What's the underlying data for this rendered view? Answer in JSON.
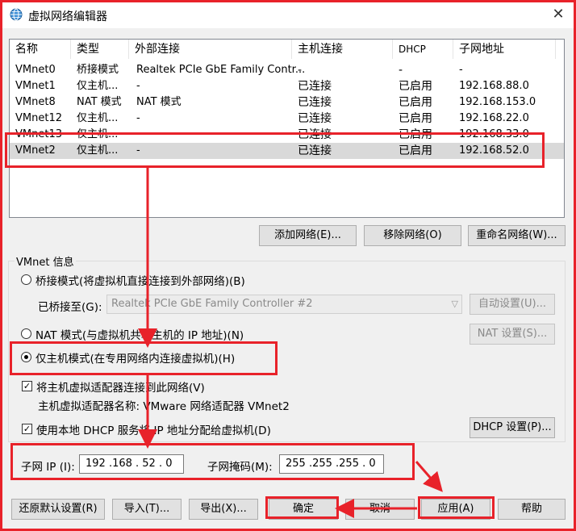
{
  "window": {
    "title": "虚拟网络编辑器",
    "icon": "globe-icon"
  },
  "table": {
    "columns": [
      "名称",
      "类型",
      "外部连接",
      "主机连接",
      "DHCP",
      "子网地址"
    ],
    "rows": [
      [
        "VMnet0",
        "桥接模式",
        "Realtek PCIe GbE Family Contr...",
        "-",
        "-",
        "-"
      ],
      [
        "VMnet1",
        "仅主机...",
        "-",
        "已连接",
        "已启用",
        "192.168.88.0"
      ],
      [
        "VMnet8",
        "NAT 模式",
        "NAT 模式",
        "已连接",
        "已启用",
        "192.168.153.0"
      ],
      [
        "VMnet12",
        "仅主机...",
        "-",
        "已连接",
        "已启用",
        "192.168.22.0"
      ],
      [
        "VMnet13",
        "仅主机...",
        "-",
        "已连接",
        "已启用",
        "192.168.33.0"
      ],
      [
        "VMnet2",
        "仅主机...",
        "-",
        "已连接",
        "已启用",
        "192.168.52.0"
      ]
    ],
    "selected_row": 5
  },
  "list_buttons": {
    "add": "添加网络(E)...",
    "remove": "移除网络(O)",
    "rename": "重命名网络(W)..."
  },
  "vmnet_info": {
    "group_label": "VMnet 信息",
    "bridged": "桥接模式(将虚拟机直接连接到外部网络)(B)",
    "bridged_to_label": "已桥接至(G):",
    "bridged_to_value": "Realtek PCIe GbE Family Controller #2",
    "auto_settings": "自动设置(U)...",
    "nat": "NAT 模式(与虚拟机共享主机的 IP 地址)(N)",
    "nat_settings": "NAT 设置(S)...",
    "hostonly": "仅主机模式(在专用网络内连接虚拟机)(H)",
    "selected_mode": "hostonly",
    "connect_adapter": "将主机虚拟适配器连接到此网络(V)",
    "connect_adapter_checked": true,
    "adapter_name": "主机虚拟适配器名称: VMware 网络适配器 VMnet2",
    "use_dhcp": "使用本地 DHCP 服务将 IP 地址分配给虚拟机(D)",
    "use_dhcp_checked": true,
    "dhcp_settings": "DHCP 设置(P)...",
    "subnet_ip_label": "子网 IP (I):",
    "subnet_ip": "192 .168 . 52  .  0",
    "subnet_mask_label": "子网掩码(M):",
    "subnet_mask": "255 .255 .255 .  0"
  },
  "footer": {
    "restore": "还原默认设置(R)",
    "import": "导入(T)...",
    "export": "导出(X)...",
    "ok": "确定",
    "cancel": "取消",
    "apply": "应用(A)",
    "help": "帮助"
  },
  "annotation_color": "#e8222a"
}
